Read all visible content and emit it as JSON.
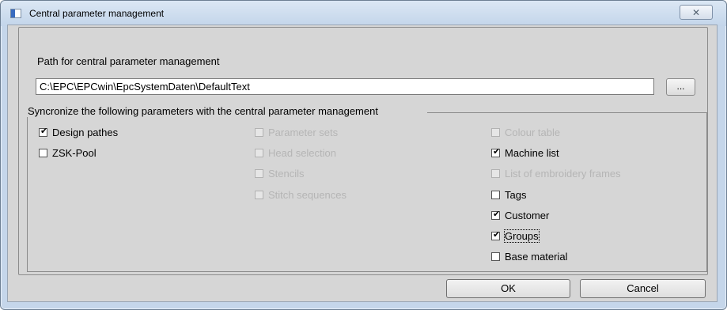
{
  "window": {
    "title": "Central parameter management",
    "close_icon": "close-icon"
  },
  "path": {
    "label": "Path for central parameter management",
    "value": "C:\\EPC\\EPCwin\\EpcSystemDaten\\DefaultText",
    "browse_label": "..."
  },
  "sync": {
    "title": "Syncronize the following parameters with the central parameter management",
    "col1": [
      {
        "label": "Design pathes",
        "checked": true,
        "enabled": true
      },
      {
        "label": "ZSK-Pool",
        "checked": false,
        "enabled": true
      }
    ],
    "col2": [
      {
        "label": "Parameter sets",
        "checked": false,
        "enabled": false
      },
      {
        "label": "Head selection",
        "checked": false,
        "enabled": false
      },
      {
        "label": "Stencils",
        "checked": false,
        "enabled": false
      },
      {
        "label": "Stitch sequences",
        "checked": false,
        "enabled": false
      }
    ],
    "col3": [
      {
        "label": "Colour table",
        "checked": false,
        "enabled": false
      },
      {
        "label": "Machine list",
        "checked": true,
        "enabled": true
      },
      {
        "label": "List of embroidery frames",
        "checked": false,
        "enabled": false
      },
      {
        "label": "Tags",
        "checked": false,
        "enabled": true
      },
      {
        "label": "Customer",
        "checked": true,
        "enabled": true
      },
      {
        "label": "Groups",
        "checked": true,
        "enabled": true
      },
      {
        "label": "Base material",
        "checked": false,
        "enabled": true
      }
    ]
  },
  "buttons": {
    "ok": "OK",
    "cancel": "Cancel"
  }
}
